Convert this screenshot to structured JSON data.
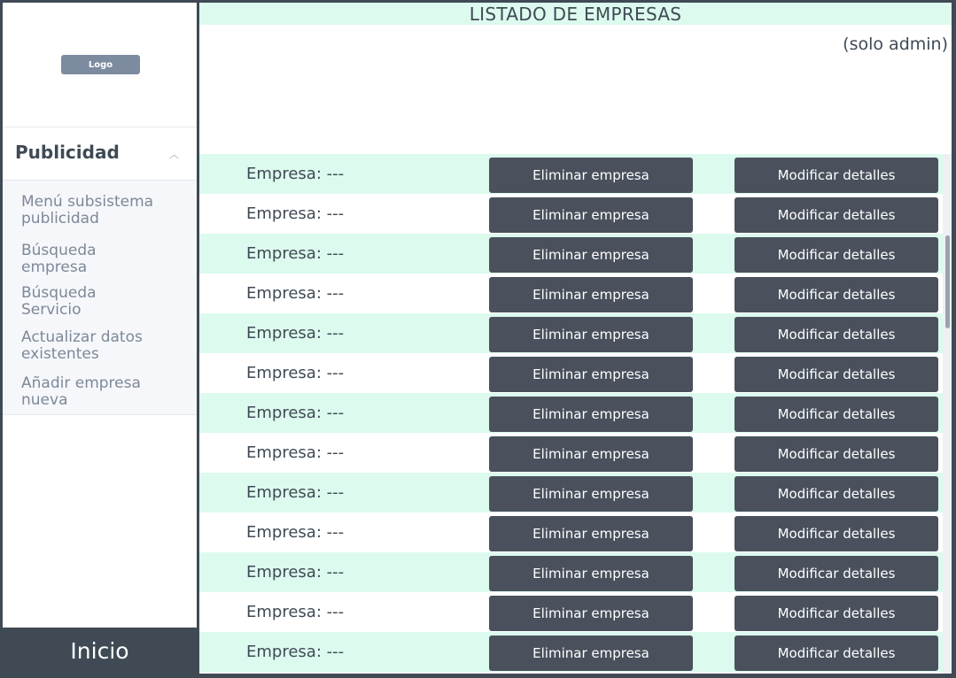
{
  "sidebar": {
    "logo_label": "Logo",
    "section_title": "Publicidad",
    "items": [
      {
        "label": "Menú subsistema publicidad"
      },
      {
        "label": "Búsqueda empresa"
      },
      {
        "label": "Búsqueda Servicio"
      },
      {
        "label": "Actualizar datos existentes"
      },
      {
        "label": "Añadir empresa nueva"
      }
    ],
    "home_label": "Inicio"
  },
  "main": {
    "title": "LISTADO DE EMPRESAS",
    "admin_note": "(solo admin)",
    "rows": [
      {
        "company": "Empresa: ---",
        "delete_label": "Eliminar empresa",
        "modify_label": "Modificar detalles"
      },
      {
        "company": "Empresa: ---",
        "delete_label": "Eliminar empresa",
        "modify_label": "Modificar detalles"
      },
      {
        "company": "Empresa: ---",
        "delete_label": "Eliminar empresa",
        "modify_label": "Modificar detalles"
      },
      {
        "company": "Empresa: ---",
        "delete_label": "Eliminar empresa",
        "modify_label": "Modificar detalles"
      },
      {
        "company": "Empresa: ---",
        "delete_label": "Eliminar empresa",
        "modify_label": "Modificar detalles"
      },
      {
        "company": "Empresa: ---",
        "delete_label": "Eliminar empresa",
        "modify_label": "Modificar detalles"
      },
      {
        "company": "Empresa: ---",
        "delete_label": "Eliminar empresa",
        "modify_label": "Modificar detalles"
      },
      {
        "company": "Empresa: ---",
        "delete_label": "Eliminar empresa",
        "modify_label": "Modificar detalles"
      },
      {
        "company": "Empresa: ---",
        "delete_label": "Eliminar empresa",
        "modify_label": "Modificar detalles"
      },
      {
        "company": "Empresa: ---",
        "delete_label": "Eliminar empresa",
        "modify_label": "Modificar detalles"
      },
      {
        "company": "Empresa: ---",
        "delete_label": "Eliminar empresa",
        "modify_label": "Modificar detalles"
      },
      {
        "company": "Empresa: ---",
        "delete_label": "Eliminar empresa",
        "modify_label": "Modificar detalles"
      },
      {
        "company": "Empresa: ---",
        "delete_label": "Eliminar empresa",
        "modify_label": "Modificar detalles"
      }
    ]
  },
  "colors": {
    "frame": "#3f4a55",
    "row_highlight": "#dcfaee",
    "button": "#4a515d",
    "menu_text": "#7d8898"
  }
}
